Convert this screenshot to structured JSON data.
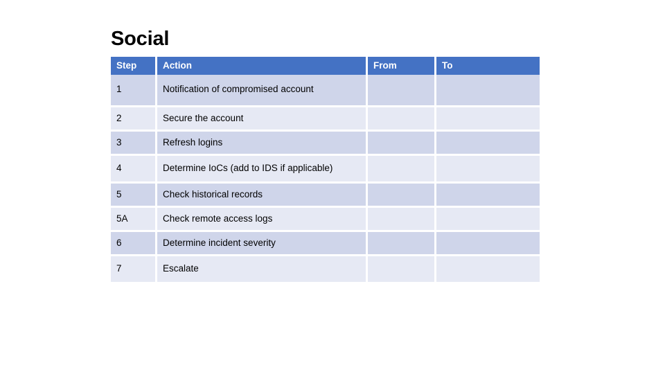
{
  "slide": {
    "title": "Social",
    "background_color": "#FFFFFF"
  },
  "theme": {
    "header_fill": "#4472C4",
    "header_text": "#FFFFFF",
    "band_dark": "#CFD5EA",
    "band_light": "#E6E9F4",
    "gridline": "#FFFFFF",
    "body_text": "#000000"
  },
  "table": {
    "columns": [
      {
        "key": "step",
        "label": "Step"
      },
      {
        "key": "action",
        "label": "Action"
      },
      {
        "key": "from",
        "label": "From"
      },
      {
        "key": "to",
        "label": "To"
      }
    ],
    "rows": [
      {
        "step": "1",
        "action": "Notification of compromised account",
        "from": "",
        "to": ""
      },
      {
        "step": "2",
        "action": "Secure the account",
        "from": "",
        "to": ""
      },
      {
        "step": "3",
        "action": "Refresh logins",
        "from": "",
        "to": ""
      },
      {
        "step": "4",
        "action": "Determine IoCs (add to IDS if applicable)",
        "from": "",
        "to": ""
      },
      {
        "step": "5",
        "action": "Check historical records",
        "from": "",
        "to": ""
      },
      {
        "step": "5A",
        "action": "Check remote access logs",
        "from": "",
        "to": ""
      },
      {
        "step": "6",
        "action": "Determine incident severity",
        "from": "",
        "to": ""
      },
      {
        "step": "7",
        "action": "Escalate",
        "from": "",
        "to": ""
      }
    ]
  }
}
